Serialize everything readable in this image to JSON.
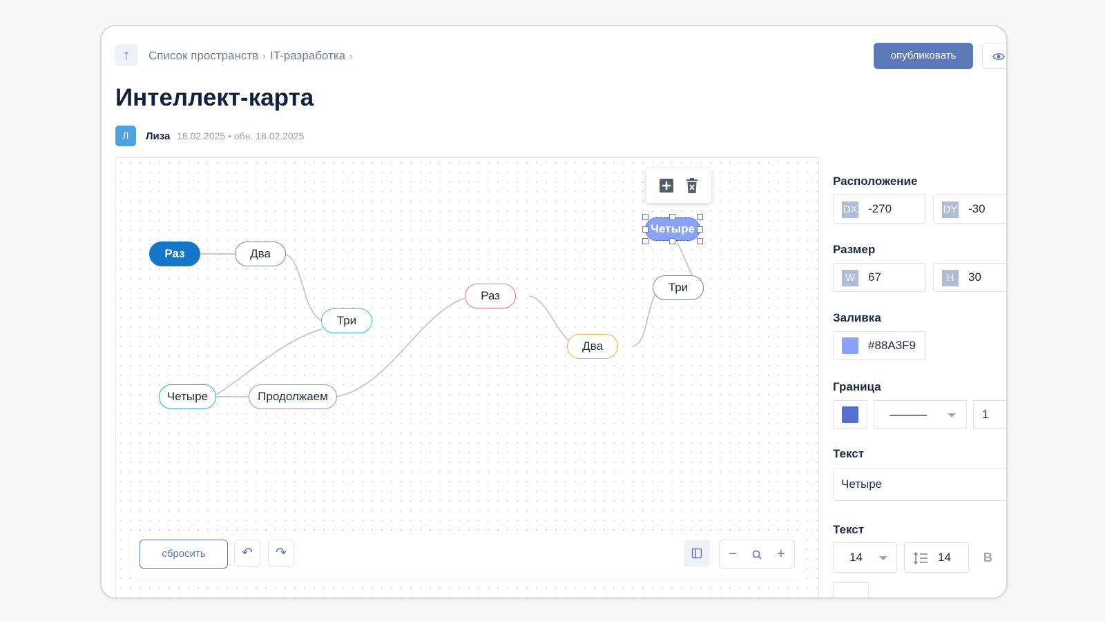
{
  "header": {
    "breadcrumb": [
      "Список пространств",
      "IT-разработка"
    ],
    "breadcrumb_sep": "›",
    "publish_label": "опубликовать",
    "title": "Интеллект-карта",
    "author_initial": "Л",
    "author": "Лиза",
    "created": "18.02.2025",
    "dot": "•",
    "updated": "обн. 18.02.2025"
  },
  "mindmap": {
    "nodes": {
      "raz_root": "Раз",
      "dva_1": "Два",
      "tri_1": "Три",
      "chetyre_1": "Четыре",
      "prodolzhaem": "Продолжаем",
      "raz_2": "Раз",
      "dva_2": "Два",
      "tri_2": "Три",
      "chetyre_selected": "Четыре"
    },
    "colors": {
      "root_fill": "#1577C9",
      "selected_fill": "#88A3F9",
      "tri_1_border": "#2EC4C6",
      "chetyre_1_border": "#2FA6E0",
      "prodolzhaem_border": "#A58BD6",
      "raz_2_border": "#EC6F92",
      "dva_2_border": "#F2B33C"
    }
  },
  "toolbar": {
    "reset_label": "сбросить",
    "undo_icon": "↶",
    "redo_icon": "↷",
    "zoom_out": "−",
    "zoom_in": "+"
  },
  "panel": {
    "position_label": "Расположение",
    "dx_tag": "DX",
    "dx": "-270",
    "dy_tag": "DY",
    "dy": "-30",
    "size_label": "Размер",
    "w_tag": "W",
    "w": "67",
    "h_tag": "H",
    "h": "30",
    "fill_label": "Заливка",
    "fill_value": "#88A3F9",
    "border_label": "Граница",
    "border_color": "#5570D0",
    "border_width": "1",
    "text_label": "Текст",
    "text_value": "Четыре",
    "text2_label": "Текст",
    "font_size": "14",
    "line_height": "14"
  }
}
